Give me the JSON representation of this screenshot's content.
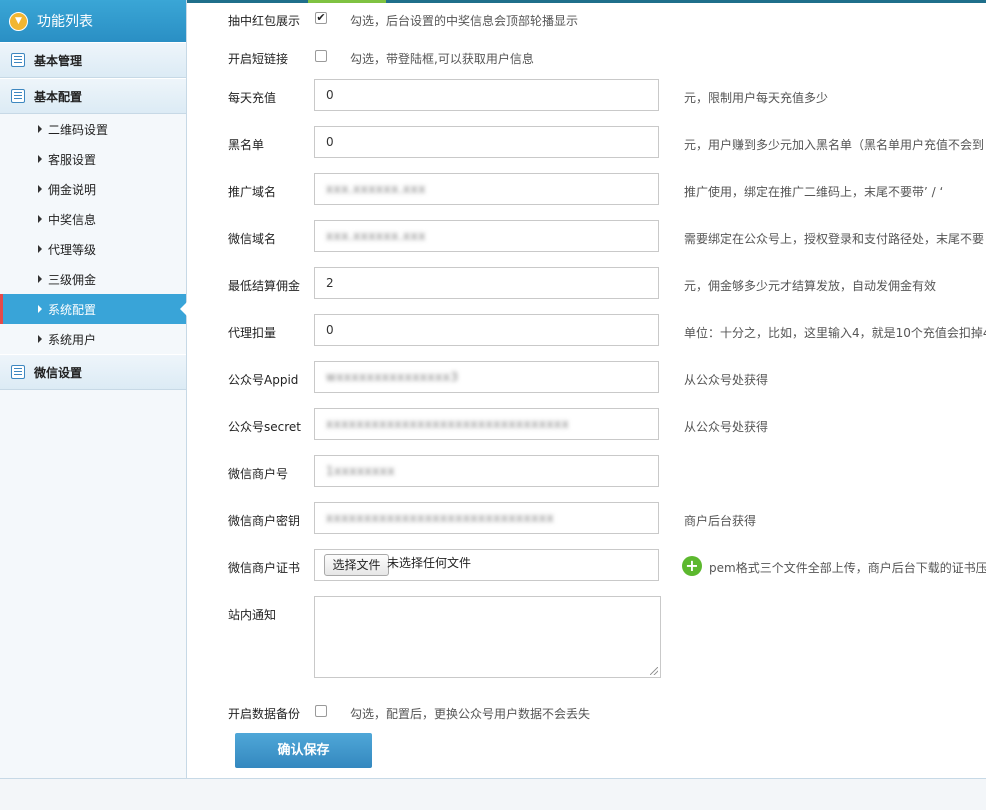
{
  "sidebar": {
    "title": "功能列表",
    "groups": [
      {
        "label": "基本管理"
      },
      {
        "label": "基本配置"
      },
      {
        "label": "微信设置"
      }
    ],
    "items": [
      {
        "label": "二维码设置"
      },
      {
        "label": "客服设置"
      },
      {
        "label": "佣金说明"
      },
      {
        "label": "中奖信息"
      },
      {
        "label": "代理等级"
      },
      {
        "label": "三级佣金"
      },
      {
        "label": "系统配置"
      },
      {
        "label": "系统用户"
      }
    ],
    "active_item": "系统配置"
  },
  "form": {
    "lucky_show": {
      "label": "抽中红包展示",
      "checked": true,
      "hint": "勾选，后台设置的中奖信息会顶部轮播显示"
    },
    "short_link": {
      "label": "开启短链接",
      "checked": false,
      "hint": "勾选，带登陆框,可以获取用户信息"
    },
    "daily_recharge": {
      "label": "每天充值",
      "value": "0",
      "hint": "元，限制用户每天充值多少"
    },
    "blacklist": {
      "label": "黑名单",
      "value": "0",
      "hint": "元，用户赚到多少元加入黑名单（黑名单用户充值不会到"
    },
    "promo_domain": {
      "label": "推广域名",
      "value": "xxx.xxxxxx.xxx",
      "hint": "推广使用，绑定在推广二维码上，末尾不要带’ / ‘"
    },
    "wechat_domain": {
      "label": "微信域名",
      "value": "xxx.xxxxxx.xxx",
      "hint": "需要绑定在公众号上，授权登录和支付路径处，末尾不要"
    },
    "min_settle": {
      "label": "最低结算佣金",
      "value": "2",
      "hint": "元，佣金够多少元才结算发放，自动发佣金有效"
    },
    "agent_deduct": {
      "label": "代理扣量",
      "value": "0",
      "hint": "单位：十分之，比如，这里输入4，就是10个充值会扣掉4"
    },
    "appid": {
      "label": "公众号Appid",
      "value": "wxxxxxxxxxxxxxxx3",
      "hint": "从公众号处获得"
    },
    "secret": {
      "label": "公众号secret",
      "value": "xxxxxxxxxxxxxxxxxxxxxxxxxxxxxxxx",
      "hint": "从公众号处获得"
    },
    "mch_id": {
      "label": "微信商户号",
      "value": "1xxxxxxxx"
    },
    "mch_key": {
      "label": "微信商户密钥",
      "value": "xxxxxxxxxxxxxxxxxxxxxxxxxxxxxx",
      "hint": "商户后台获得"
    },
    "mch_cert": {
      "label": "微信商户证书",
      "button": "选择文件",
      "file_text": "未选择任何文件",
      "hint": "pem格式三个文件全部上传，商户后台下载的证书压"
    },
    "notice": {
      "label": "站内通知",
      "value": ""
    },
    "backup": {
      "label": "开启数据备份",
      "checked": false,
      "hint": "勾选，配置后，更换公众号用户数据不会丢失"
    },
    "save_label": "确认保存"
  },
  "colors": {
    "accent": "#39a4d8",
    "save": "#3a8fc5",
    "active_marker": "#e54a4a",
    "plus": "#5cb82e"
  }
}
